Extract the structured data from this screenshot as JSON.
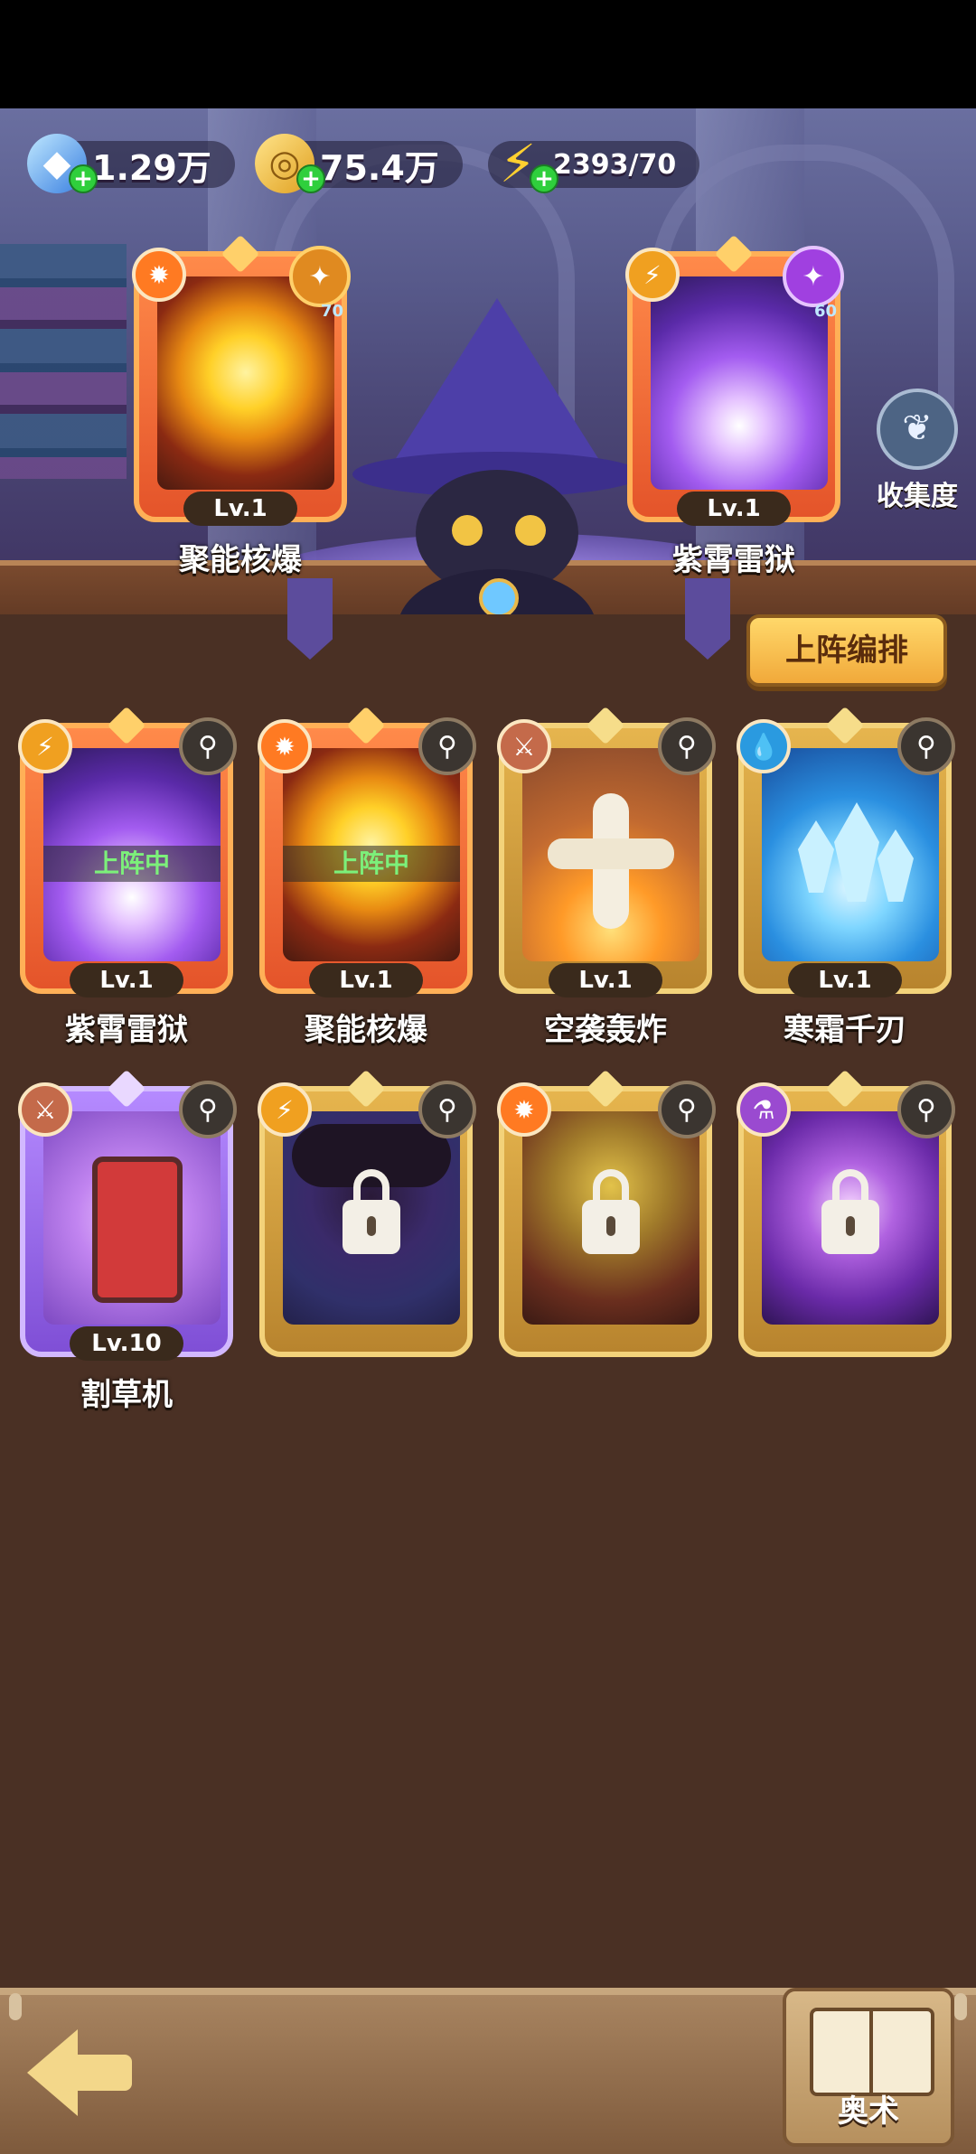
{
  "resources": {
    "diamond": "1.29万",
    "gold": "75.4万",
    "energy": "2393/70"
  },
  "equipped": [
    {
      "name": "聚能核爆",
      "level": "Lv.1",
      "element": "fire",
      "power": "70"
    },
    {
      "name": "紫霄雷狱",
      "level": "Lv.1",
      "element": "lightning",
      "power": "60"
    }
  ],
  "collection_label": "收集度",
  "formation_button": "上阵编排",
  "deployed_tag": "上阵中",
  "cards": [
    {
      "name": "紫霄雷狱",
      "level": "Lv.1",
      "element": "lightning",
      "deployed": true,
      "locked": false
    },
    {
      "name": "聚能核爆",
      "level": "Lv.1",
      "element": "fire",
      "deployed": true,
      "locked": false
    },
    {
      "name": "空袭轰炸",
      "level": "Lv.1",
      "element": "physical",
      "deployed": false,
      "locked": false
    },
    {
      "name": "寒霜千刃",
      "level": "Lv.1",
      "element": "water",
      "deployed": false,
      "locked": false
    },
    {
      "name": "割草机",
      "level": "Lv.10",
      "element": "physical",
      "deployed": false,
      "locked": false
    },
    {
      "name": "",
      "level": "",
      "element": "lightning",
      "deployed": false,
      "locked": true
    },
    {
      "name": "",
      "level": "",
      "element": "fire",
      "deployed": false,
      "locked": true
    },
    {
      "name": "",
      "level": "",
      "element": "poison",
      "deployed": false,
      "locked": true
    }
  ],
  "arcane_label": "奥术",
  "colors": {
    "background": "#4a3024",
    "accent_button": "#f1a93a",
    "deployed_text": "#7cf07a"
  }
}
